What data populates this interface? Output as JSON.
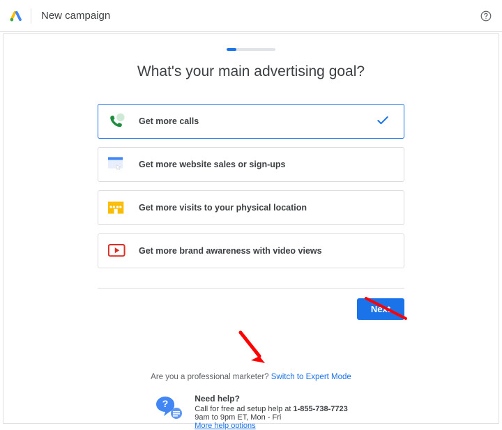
{
  "header": {
    "title": "New campaign"
  },
  "page_title": "What's your main advertising goal?",
  "options": [
    {
      "label": "Get more calls",
      "selected": true
    },
    {
      "label": "Get more website sales or sign-ups",
      "selected": false
    },
    {
      "label": "Get more visits to your physical location",
      "selected": false
    },
    {
      "label": "Get more brand awareness with video views",
      "selected": false
    }
  ],
  "next_button": "Next",
  "expert": {
    "prompt": "Are you a professional marketer? ",
    "link": "Switch to Expert Mode"
  },
  "help": {
    "title": "Need help?",
    "line1_prefix": "Call for free ad setup help at ",
    "phone": "1-855-738-7723",
    "line2": "9am to 9pm ET, Mon - Fri",
    "more": "More help options"
  }
}
